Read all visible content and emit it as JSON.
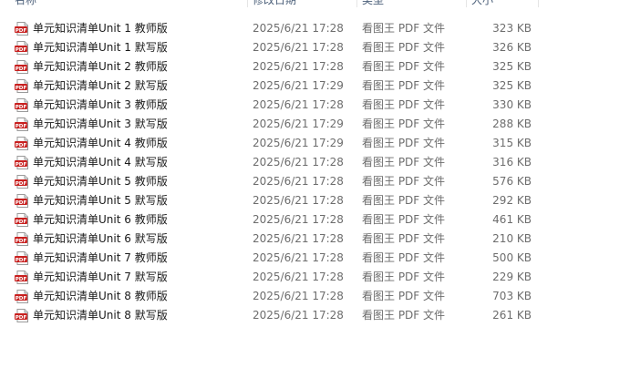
{
  "columns": {
    "name": "名称",
    "date": "修改日期",
    "type": "类型",
    "size": "大小"
  },
  "icon": "pdf-file-icon",
  "icon_label": "PDF",
  "colors": {
    "pdf_icon": "#c8201f",
    "header_text": "#4c607a",
    "detail_text": "#6d6d6d"
  },
  "files": [
    {
      "name": "单元知识清单Unit 1 教师版",
      "date": "2025/6/21 17:28",
      "type": "看图王 PDF 文件",
      "size": "323 KB"
    },
    {
      "name": "单元知识清单Unit 1 默写版",
      "date": "2025/6/21 17:28",
      "type": "看图王 PDF 文件",
      "size": "326 KB"
    },
    {
      "name": "单元知识清单Unit 2 教师版",
      "date": "2025/6/21 17:28",
      "type": "看图王 PDF 文件",
      "size": "325 KB"
    },
    {
      "name": "单元知识清单Unit 2 默写版",
      "date": "2025/6/21 17:29",
      "type": "看图王 PDF 文件",
      "size": "325 KB"
    },
    {
      "name": "单元知识清单Unit 3 教师版",
      "date": "2025/6/21 17:28",
      "type": "看图王 PDF 文件",
      "size": "330 KB"
    },
    {
      "name": "单元知识清单Unit 3 默写版",
      "date": "2025/6/21 17:29",
      "type": "看图王 PDF 文件",
      "size": "288 KB"
    },
    {
      "name": "单元知识清单Unit 4 教师版",
      "date": "2025/6/21 17:29",
      "type": "看图王 PDF 文件",
      "size": "315 KB"
    },
    {
      "name": "单元知识清单Unit 4 默写版",
      "date": "2025/6/21 17:28",
      "type": "看图王 PDF 文件",
      "size": "316 KB"
    },
    {
      "name": "单元知识清单Unit 5 教师版",
      "date": "2025/6/21 17:28",
      "type": "看图王 PDF 文件",
      "size": "576 KB"
    },
    {
      "name": "单元知识清单Unit 5 默写版",
      "date": "2025/6/21 17:28",
      "type": "看图王 PDF 文件",
      "size": "292 KB"
    },
    {
      "name": "单元知识清单Unit 6 教师版",
      "date": "2025/6/21 17:28",
      "type": "看图王 PDF 文件",
      "size": "461 KB"
    },
    {
      "name": "单元知识清单Unit 6 默写版",
      "date": "2025/6/21 17:28",
      "type": "看图王 PDF 文件",
      "size": "210 KB"
    },
    {
      "name": "单元知识清单Unit 7 教师版",
      "date": "2025/6/21 17:28",
      "type": "看图王 PDF 文件",
      "size": "500 KB"
    },
    {
      "name": "单元知识清单Unit 7 默写版",
      "date": "2025/6/21 17:28",
      "type": "看图王 PDF 文件",
      "size": "229 KB"
    },
    {
      "name": "单元知识清单Unit 8 教师版",
      "date": "2025/6/21 17:28",
      "type": "看图王 PDF 文件",
      "size": "703 KB"
    },
    {
      "name": "单元知识清单Unit 8 默写版",
      "date": "2025/6/21 17:28",
      "type": "看图王 PDF 文件",
      "size": "261 KB"
    }
  ]
}
